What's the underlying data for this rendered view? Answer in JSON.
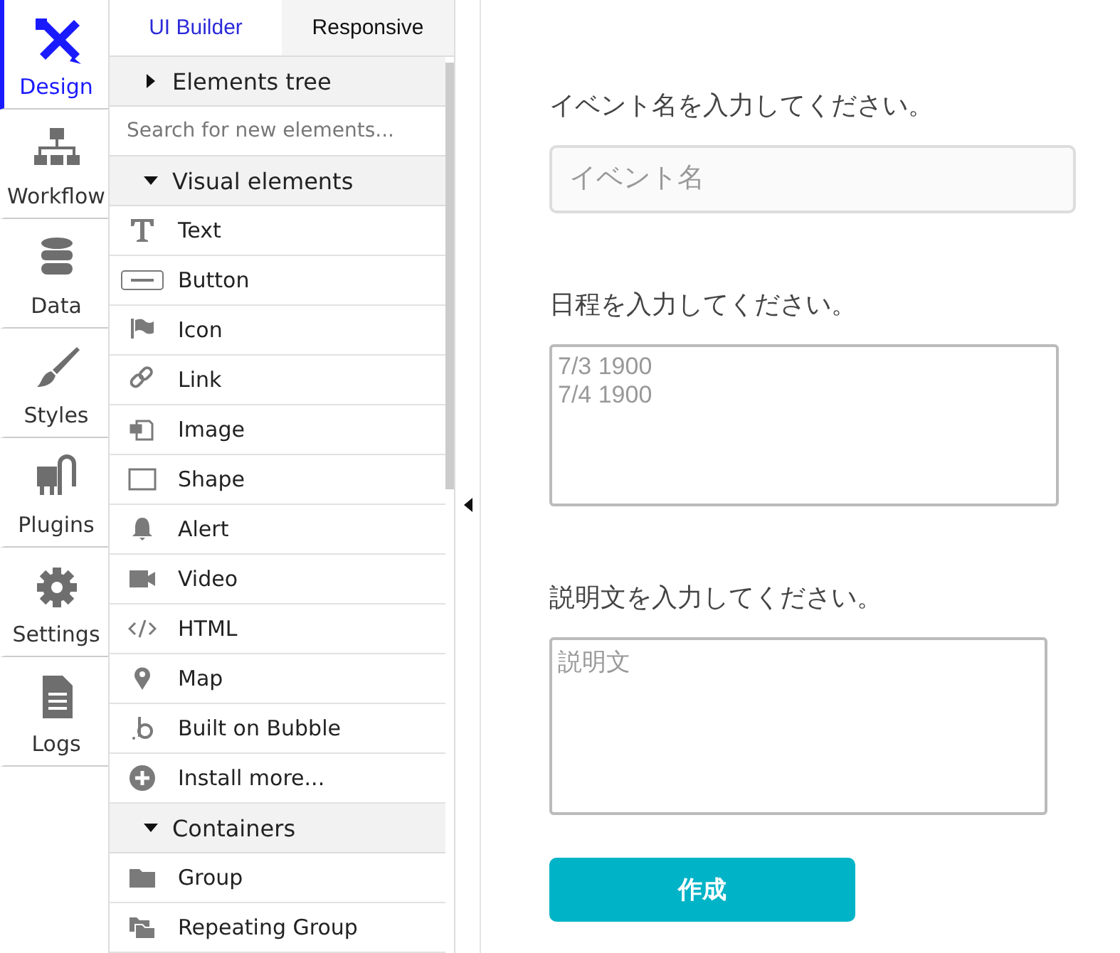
{
  "nav": [
    {
      "label": "Design",
      "kind": "design",
      "selected": true
    },
    {
      "label": "Workflow",
      "kind": "workflow",
      "selected": false
    },
    {
      "label": "Data",
      "kind": "data",
      "selected": false
    },
    {
      "label": "Styles",
      "kind": "styles",
      "selected": false
    },
    {
      "label": "Plugins",
      "kind": "plugins",
      "selected": false
    },
    {
      "label": "Settings",
      "kind": "settings",
      "selected": false
    },
    {
      "label": "Logs",
      "kind": "logs",
      "selected": false
    }
  ],
  "tabs": [
    {
      "label": "UI Builder",
      "selected": true
    },
    {
      "label": "Responsive",
      "selected": false
    }
  ],
  "elements_tree": {
    "label": "Elements tree",
    "expanded": false
  },
  "search": {
    "placeholder": "Search for new elements..."
  },
  "sections": [
    {
      "label": "Visual elements",
      "expanded": true,
      "items": [
        {
          "label": "Text",
          "kind": "text"
        },
        {
          "label": "Button",
          "kind": "button"
        },
        {
          "label": "Icon",
          "kind": "flag"
        },
        {
          "label": "Link",
          "kind": "link"
        },
        {
          "label": "Image",
          "kind": "image"
        },
        {
          "label": "Shape",
          "kind": "shape"
        },
        {
          "label": "Alert",
          "kind": "bell"
        },
        {
          "label": "Video",
          "kind": "video"
        },
        {
          "label": "HTML",
          "kind": "code"
        },
        {
          "label": "Map",
          "kind": "pin"
        },
        {
          "label": "Built on Bubble",
          "kind": "bubble"
        },
        {
          "label": "Install more...",
          "kind": "plus"
        }
      ]
    },
    {
      "label": "Containers",
      "expanded": true,
      "items": [
        {
          "label": "Group",
          "kind": "folder"
        },
        {
          "label": "Repeating Group",
          "kind": "folders"
        }
      ]
    }
  ],
  "canvas": {
    "fields": [
      {
        "label": "イベント名を入力してください。",
        "kind": "input",
        "placeholder": "イベント名"
      },
      {
        "label": "日程を入力してください。",
        "kind": "textarea",
        "placeholder": "7/3 1900\n7/4 1900"
      },
      {
        "label": "説明文を入力してください。",
        "kind": "textarea",
        "placeholder": "説明文"
      }
    ],
    "button": "作成"
  }
}
